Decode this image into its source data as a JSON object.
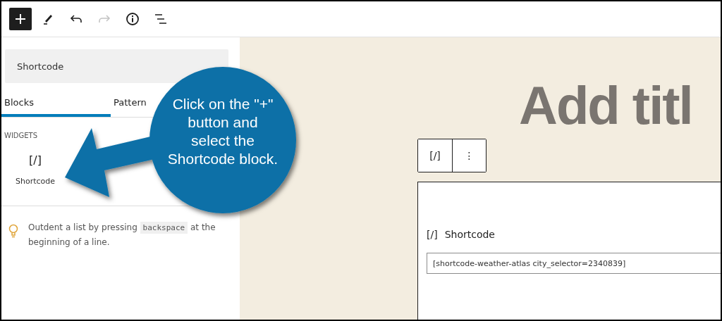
{
  "toolbar": [
    {
      "kind": "add",
      "pressed": true,
      "disabled": false
    },
    {
      "kind": "edit",
      "pressed": false,
      "disabled": false
    },
    {
      "kind": "undo",
      "pressed": false,
      "disabled": false
    },
    {
      "kind": "redo",
      "pressed": false,
      "disabled": true
    },
    {
      "kind": "info",
      "pressed": false,
      "disabled": false
    },
    {
      "kind": "outline",
      "pressed": false,
      "disabled": false
    }
  ],
  "inserter": {
    "search": {
      "value": "Shortcode"
    },
    "tabs": [
      {
        "label": "Blocks",
        "selected": true
      },
      {
        "label": "Pattern",
        "selected": false
      }
    ],
    "category": "WIDGETS",
    "blocks": [
      {
        "icon": "[/]",
        "label": "Shortcode"
      }
    ],
    "tip": {
      "before": "Outdent a list by pressing",
      "key": "backspace",
      "after": "at the beginning of a line."
    }
  },
  "editor": {
    "title_placeholder": "Add titl",
    "block_toolbar": {
      "icon": "[/]",
      "more": "⋮"
    },
    "block": {
      "icon": "[/]",
      "label": "Shortcode",
      "value": "[shortcode-weather-atlas city_selector=2340839]"
    }
  },
  "callout": {
    "lines": [
      "Click on the \"+\"",
      "button and",
      "select the",
      "Shortcode block."
    ]
  }
}
